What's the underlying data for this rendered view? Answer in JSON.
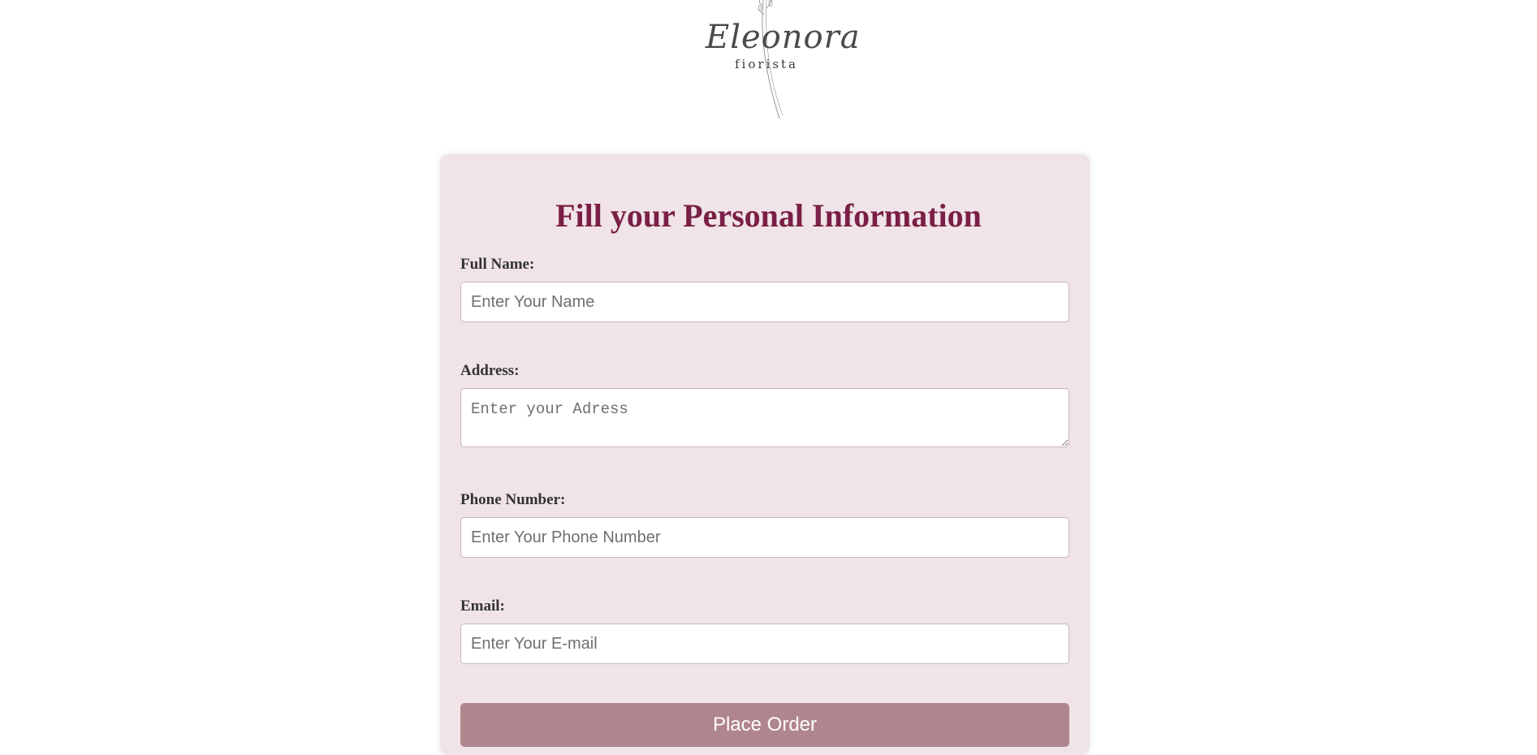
{
  "brand": {
    "logo_script": "Eleonora",
    "logo_subtitle": "fiorista"
  },
  "form": {
    "title": "Fill your Personal Information",
    "fields": {
      "full_name": {
        "label": "Full Name:",
        "placeholder": "Enter Your Name",
        "value": ""
      },
      "address": {
        "label": "Address:",
        "placeholder": "Enter your Adress",
        "value": ""
      },
      "phone": {
        "label": "Phone Number:",
        "placeholder": "Enter Your Phone Number",
        "value": ""
      },
      "email": {
        "label": "Email:",
        "placeholder": "Enter Your E-mail",
        "value": ""
      }
    },
    "submit_label": "Place Order"
  },
  "colors": {
    "card_background": "#f0e4e8",
    "title": "#7a1f45",
    "button": "#b0868e",
    "button_text": "#ffffff"
  }
}
